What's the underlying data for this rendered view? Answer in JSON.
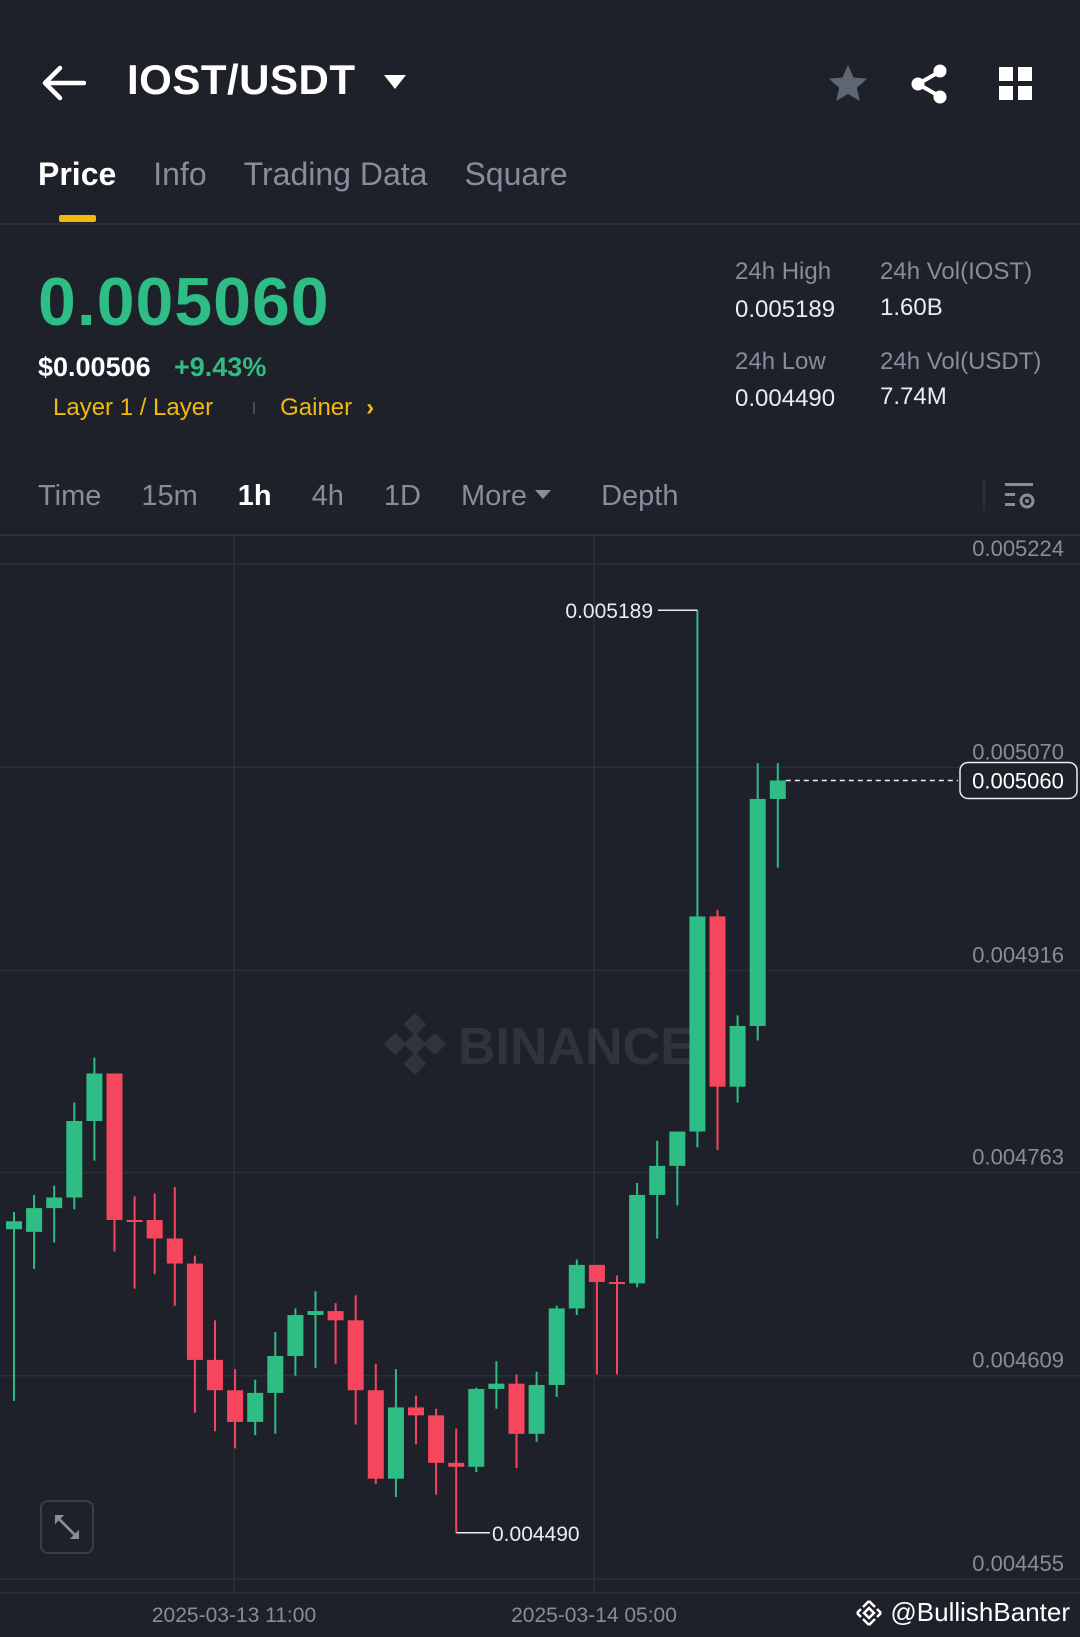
{
  "header": {
    "pair": "IOST/USDT",
    "back_icon": "arrow-left-icon",
    "favorite_icon": "star-icon",
    "share_icon": "share-icon",
    "menu_icon": "grid-icon"
  },
  "tabs": [
    {
      "label": "Price",
      "active": true
    },
    {
      "label": "Info",
      "active": false
    },
    {
      "label": "Trading Data",
      "active": false
    },
    {
      "label": "Square",
      "active": false
    }
  ],
  "ticker": {
    "last_price": "0.005060",
    "usd_price": "$0.00506",
    "change_pct": "+9.43%",
    "tag_category": "Layer 1 / Layer",
    "tag_gainer": "Gainer",
    "tag_chevron": "›"
  },
  "stats": {
    "high_label": "24h High",
    "high_value": "0.005189",
    "low_label": "24h Low",
    "low_value": "0.004490",
    "vol_base_label": "24h Vol(IOST)",
    "vol_base_value": "1.60B",
    "vol_quote_label": "24h Vol(USDT)",
    "vol_quote_value": "7.74M"
  },
  "intervals": {
    "items": [
      "Time",
      "15m",
      "1h",
      "4h",
      "1D",
      "More",
      "Depth"
    ],
    "active": "1h"
  },
  "chart_data": {
    "type": "candlestick",
    "interval": "1h",
    "watermark_text": "BINANCE",
    "y_ticks": [
      "0.005224",
      "0.005070",
      "0.004916",
      "0.004763",
      "0.004609",
      "0.004455"
    ],
    "x_ticks": [
      "2025-03-13 11:00",
      "2025-03-14 05:00"
    ],
    "high_marker": "0.005189",
    "low_marker": "0.004490",
    "last_price_label": "0.005060",
    "ylim": [
      0.004455,
      0.005224
    ],
    "candles": [
      {
        "o": 0.00472,
        "h": 0.004733,
        "l": 0.00459,
        "c": 0.004726
      },
      {
        "o": 0.004718,
        "h": 0.004746,
        "l": 0.00469,
        "c": 0.004736
      },
      {
        "o": 0.004736,
        "h": 0.004753,
        "l": 0.00471,
        "c": 0.004744
      },
      {
        "o": 0.004744,
        "h": 0.004816,
        "l": 0.004735,
        "c": 0.004802
      },
      {
        "o": 0.004802,
        "h": 0.00485,
        "l": 0.004772,
        "c": 0.004838
      },
      {
        "o": 0.004838,
        "h": 0.004838,
        "l": 0.004703,
        "c": 0.004727
      },
      {
        "o": 0.004727,
        "h": 0.004745,
        "l": 0.004675,
        "c": 0.004726
      },
      {
        "o": 0.004727,
        "h": 0.004747,
        "l": 0.004686,
        "c": 0.004713
      },
      {
        "o": 0.004713,
        "h": 0.004752,
        "l": 0.004662,
        "c": 0.004694
      },
      {
        "o": 0.004694,
        "h": 0.0047,
        "l": 0.004581,
        "c": 0.004621
      },
      {
        "o": 0.004621,
        "h": 0.004651,
        "l": 0.004567,
        "c": 0.004598
      },
      {
        "o": 0.004598,
        "h": 0.004614,
        "l": 0.004554,
        "c": 0.004574
      },
      {
        "o": 0.004574,
        "h": 0.004606,
        "l": 0.004564,
        "c": 0.004596
      },
      {
        "o": 0.004596,
        "h": 0.004642,
        "l": 0.004565,
        "c": 0.004624
      },
      {
        "o": 0.004624,
        "h": 0.00466,
        "l": 0.004609,
        "c": 0.004655
      },
      {
        "o": 0.004655,
        "h": 0.004673,
        "l": 0.004615,
        "c": 0.004658
      },
      {
        "o": 0.004658,
        "h": 0.004664,
        "l": 0.004618,
        "c": 0.004651
      },
      {
        "o": 0.004651,
        "h": 0.00467,
        "l": 0.004572,
        "c": 0.004598
      },
      {
        "o": 0.004598,
        "h": 0.004618,
        "l": 0.004527,
        "c": 0.004531
      },
      {
        "o": 0.004531,
        "h": 0.004614,
        "l": 0.004517,
        "c": 0.004585
      },
      {
        "o": 0.004585,
        "h": 0.004594,
        "l": 0.004557,
        "c": 0.004579
      },
      {
        "o": 0.004579,
        "h": 0.004584,
        "l": 0.004519,
        "c": 0.004543
      },
      {
        "o": 0.004543,
        "h": 0.004569,
        "l": 0.00449,
        "c": 0.00454
      },
      {
        "o": 0.00454,
        "h": 0.0046,
        "l": 0.004536,
        "c": 0.004599
      },
      {
        "o": 0.004599,
        "h": 0.00462,
        "l": 0.004584,
        "c": 0.004603
      },
      {
        "o": 0.004603,
        "h": 0.00461,
        "l": 0.004539,
        "c": 0.004565
      },
      {
        "o": 0.004565,
        "h": 0.004612,
        "l": 0.004559,
        "c": 0.004602
      },
      {
        "o": 0.004602,
        "h": 0.004662,
        "l": 0.004593,
        "c": 0.00466
      },
      {
        "o": 0.00466,
        "h": 0.004697,
        "l": 0.004655,
        "c": 0.004693
      },
      {
        "o": 0.004693,
        "h": 0.004693,
        "l": 0.00461,
        "c": 0.00468
      },
      {
        "o": 0.00468,
        "h": 0.004685,
        "l": 0.00461,
        "c": 0.004679
      },
      {
        "o": 0.004679,
        "h": 0.004755,
        "l": 0.004676,
        "c": 0.004746
      },
      {
        "o": 0.004746,
        "h": 0.004787,
        "l": 0.004713,
        "c": 0.004768
      },
      {
        "o": 0.004768,
        "h": 0.00479,
        "l": 0.004738,
        "c": 0.004794
      },
      {
        "o": 0.004794,
        "h": 0.005189,
        "l": 0.004782,
        "c": 0.004957
      },
      {
        "o": 0.004957,
        "h": 0.004962,
        "l": 0.00478,
        "c": 0.004828
      },
      {
        "o": 0.004828,
        "h": 0.004882,
        "l": 0.004816,
        "c": 0.004874
      },
      {
        "o": 0.004874,
        "h": 0.005073,
        "l": 0.004863,
        "c": 0.005046
      },
      {
        "o": 0.005046,
        "h": 0.005073,
        "l": 0.004994,
        "c": 0.00506
      }
    ]
  },
  "watermark": "@BullishBanter",
  "colors": {
    "bg": "#1e2129",
    "up": "#2ebd85",
    "down": "#f6465d",
    "accent": "#f0b90b",
    "muted": "#848e9c"
  }
}
